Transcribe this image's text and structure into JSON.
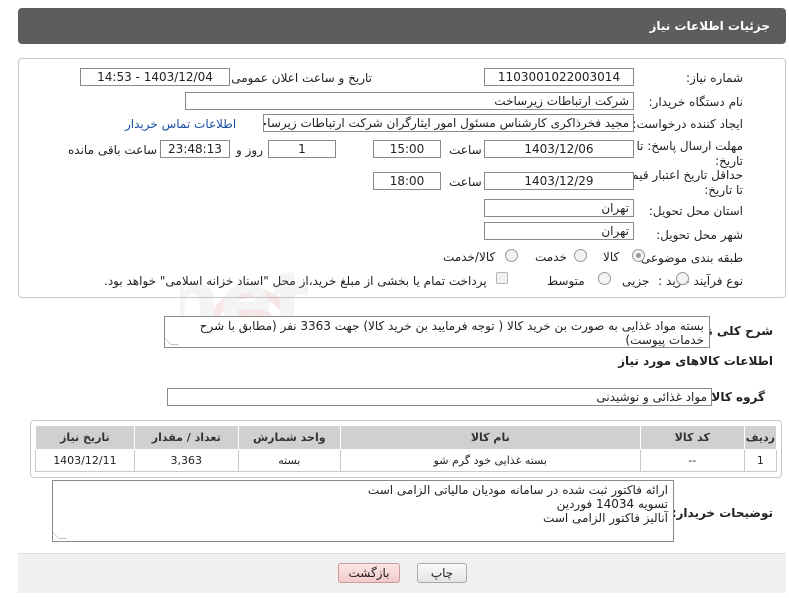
{
  "header": {
    "title": "جزئیات اطلاعات نیاز"
  },
  "fields": {
    "need_number_label": "شماره نیاز:",
    "need_number": "1103001022003014",
    "announce_label": "تاریخ و ساعت اعلان عمومی:",
    "announce_value": "1403/12/04 - 14:53",
    "buyer_org_label": "نام دستگاه خریدار:",
    "buyer_org": "شرکت ارتباطات زیرساخت",
    "requester_label": "ایجاد کننده درخواست:",
    "requester": "مجید فخرذاکری کارشناس مسئول امور ایثارگران شرکت ارتباطات زیرساخت",
    "buyer_contact_link": "اطلاعات تماس خریدار",
    "reply_deadline_label": "مهلت ارسال پاسخ: تا تاریخ:",
    "reply_date": "1403/12/06",
    "time_label": "ساعت",
    "reply_time": "15:00",
    "days_value": "1",
    "days_and_label": "روز و",
    "remaining_time": "23:48:13",
    "remaining_label": "ساعت باقی مانده",
    "price_validity_label": "حداقل تاریخ اعتبار قیمت: تا تاریخ:",
    "price_date": "1403/12/29",
    "price_time": "18:00",
    "province_label": "استان محل تحویل:",
    "province": "تهران",
    "city_label": "شهر محل تحویل:",
    "city": "تهران",
    "category_label": "طبقه بندی موضوعی:",
    "category_options": [
      "کالا",
      "خدمت",
      "کالا/خدمت"
    ],
    "process_label": "نوع فرآیند خرید :",
    "process_options": [
      "جزیی",
      "متوسط"
    ],
    "payment_note": "پرداخت تمام یا بخشی از مبلغ خرید،از محل \"اسناد خزانه اسلامی\" خواهد بود."
  },
  "description": {
    "label": "شرح کلی نیاز:",
    "text": "بسته مواد غذایی به صورت بن خرید کالا ( توجه فرمایید بن خرید کالا) جهت 3363 نفر (مطابق با شرح خدمات پیوست)"
  },
  "goods": {
    "section_title": "اطلاعات کالاهای مورد نیاز",
    "group_label": "گروه کالا:",
    "group_value": "مواد غذائی و نوشیدنی",
    "columns": [
      "ردیف",
      "کد کالا",
      "نام کالا",
      "واحد شمارش",
      "تعداد / مقدار",
      "تاریخ نیاز"
    ],
    "rows": [
      [
        "1",
        "--",
        "بسته غذایی خود گرم شو",
        "بسته",
        "3,363",
        "1403/12/11"
      ]
    ]
  },
  "buyer_notes": {
    "label": "توضیحات خریدار:",
    "lines": [
      "ارائه فاکتور ثبت شده در سامانه مودیان مالیاتی الزامی است",
      "تسویه 14034 فوردین",
      "آنالیز فاکتور الزامی است"
    ]
  },
  "buttons": {
    "print": "چاپ",
    "back": "بازگشت"
  },
  "watermark": {
    "text": "AriaTender.net"
  }
}
